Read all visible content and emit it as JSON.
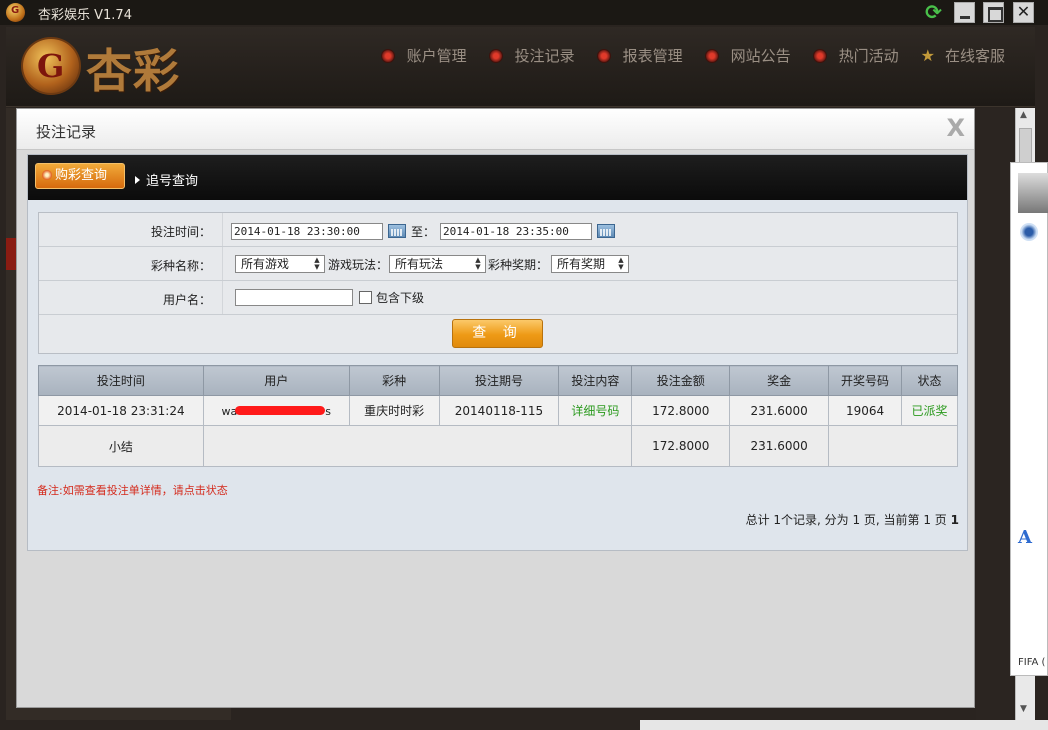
{
  "window": {
    "title": "杏彩娱乐 V1.74",
    "logo_letter": "G"
  },
  "header": {
    "logo_letter": "G",
    "brand": "杏彩",
    "nav": [
      {
        "label": "账户管理",
        "icon": "red-dot-icon"
      },
      {
        "label": "投注记录",
        "icon": "red-dot-icon"
      },
      {
        "label": "报表管理",
        "icon": "red-dot-icon"
      },
      {
        "label": "网站公告",
        "icon": "red-dot-icon"
      },
      {
        "label": "热门活动",
        "icon": "red-dot-icon"
      },
      {
        "label": "在线客服",
        "icon": "star-icon"
      }
    ]
  },
  "modal": {
    "title": "投注记录",
    "close": "X",
    "tabs": {
      "active": "购彩查询",
      "inactive": "追号查询"
    },
    "form": {
      "time_label": "投注时间：",
      "time_from": "2014-01-18 23:30:00",
      "to_label": "至：",
      "time_to": "2014-01-18 23:35:00",
      "lottery_label": "彩种名称：",
      "lottery_value": "所有游戏",
      "play_label": "游戏玩法：",
      "play_value": "所有玩法",
      "period_label": "彩种奖期：",
      "period_value": "所有奖期",
      "user_label": "用户名：",
      "user_value": "",
      "include_sub_label": "包含下级",
      "query_button": "查 询"
    },
    "table": {
      "headers": [
        "投注时间",
        "用户",
        "彩种",
        "投注期号",
        "投注内容",
        "投注金额",
        "奖金",
        "开奖号码",
        "状态"
      ],
      "rows": [
        {
          "time": "2014-01-18 23:31:24",
          "user_prefix": "wa",
          "user_suffix": "s",
          "lottery": "重庆时时彩",
          "period": "20140118-115",
          "content": "详细号码",
          "amount": "172.8000",
          "prize": "231.6000",
          "draw": "19064",
          "status": "已派奖"
        }
      ],
      "subtotal": {
        "label": "小结",
        "amount": "172.8000",
        "prize": "231.6000"
      }
    },
    "note": "备注:如需查看投注单详情，请点击状态",
    "pager": {
      "prefix": "总计 1个记录, 分为 1 页, 当前第 1 页",
      "current": "1"
    }
  },
  "side_panel": {
    "letter": "A",
    "label": "FIFA ("
  },
  "colors": {
    "accent_orange": "#ee9a16",
    "status_green": "#2b9a1e",
    "note_red": "#d42a1c"
  }
}
